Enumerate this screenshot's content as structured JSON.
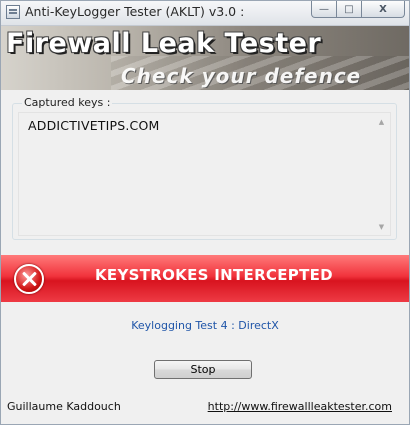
{
  "window": {
    "title": "Anti-KeyLogger Tester (AKLT) v3.0 :",
    "controls": {
      "min": "—",
      "max": "□",
      "close": "X"
    }
  },
  "banner": {
    "title": "Firewall Leak Tester",
    "subtitle": "Check your defence"
  },
  "captured": {
    "label": "Captured keys :",
    "text": "ADDICTIVETIPS.COM",
    "scroll_up": "▲",
    "scroll_down": "▼"
  },
  "alert": {
    "text": "KEYSTROKES INTERCEPTED",
    "icon": "error-x-icon",
    "color": "#e8202a"
  },
  "test": {
    "name": "Keylogging Test 4 : DirectX",
    "color": "#1f55a8"
  },
  "actions": {
    "stop_label": "Stop"
  },
  "footer": {
    "author": "Guillaume Kaddouch",
    "url": "http://www.firewallleaktester.com"
  }
}
